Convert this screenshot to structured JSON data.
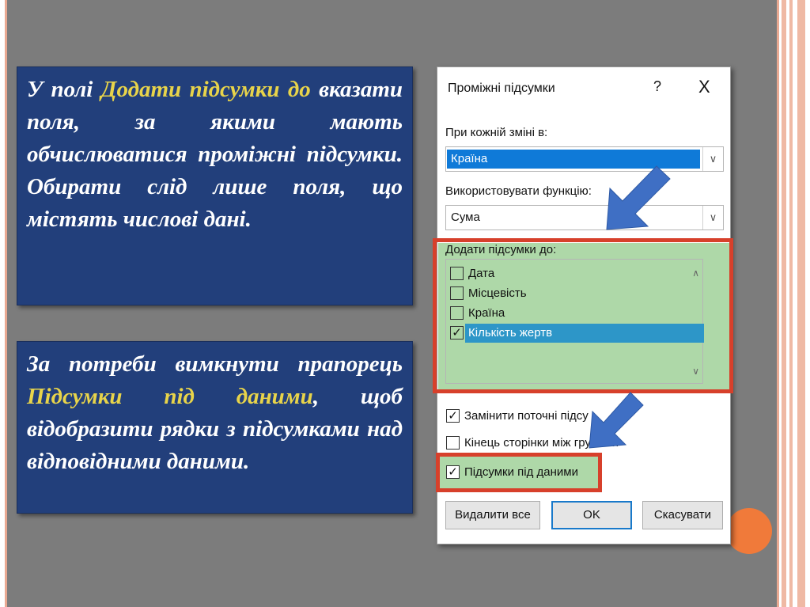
{
  "text_box_1": {
    "parts": [
      "У полі ",
      "Додати підсумки до",
      " вказати поля, за якими мають обчислюватися проміжні підсумки. Обирати слід лише поля, що містять числові дані."
    ]
  },
  "text_box_2": {
    "parts": [
      "За потреби вимкнути прапорець ",
      "Підсумки під даними",
      ", щоб відобразити рядки з підсумками над відповідними даними."
    ]
  },
  "dialog": {
    "title": "Проміжні підсумки",
    "help": "?",
    "close": "X",
    "at_each_change_label": "При кожній зміні в:",
    "at_each_change_value": "Країна",
    "use_function_label": "Використовувати функцію:",
    "use_function_value": "Сума",
    "add_subtotal_to_label": "Додати підсумки до:",
    "fields": [
      {
        "label": "Дата",
        "checked": false,
        "selected": false
      },
      {
        "label": "Місцевість",
        "checked": false,
        "selected": false
      },
      {
        "label": "Країна",
        "checked": false,
        "selected": false
      },
      {
        "label": "Кількість жертв",
        "checked": true,
        "selected": true
      }
    ],
    "replace_current": {
      "label": "Замінити поточні підсу",
      "checked": true
    },
    "page_break": {
      "label": "Кінець сторінки між групами",
      "checked": false
    },
    "summary_below": {
      "label": "Підсумки під даними",
      "checked": true
    },
    "buttons": {
      "remove_all": "Видалити все",
      "ok": "OK",
      "cancel": "Скасувати"
    }
  },
  "colors": {
    "slide_bg": "#7c7c7c",
    "text_box_bg": "#223f7b",
    "highlight_text": "#e8d44a",
    "callout_frame": "#d7402b",
    "callout_fill": "#aed8a8",
    "arrow": "#3f6fc4",
    "selection": "#0f7ad8"
  },
  "icons": {
    "check": "✓",
    "dropdown": "∨",
    "scroll_up": "∧",
    "scroll_down": "∨"
  }
}
